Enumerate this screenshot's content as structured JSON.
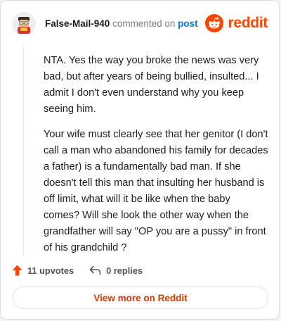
{
  "comment": {
    "username": "False-Mail-940",
    "commented_on_text": "commented on",
    "post_link": "post",
    "paragraphs": [
      "NTA. Yes the way you broke the news was very bad, but after years of being bullied, insulted... I admit I don't even understand why you keep seeing him.",
      "Your wife must clearly see that her genitor (I don't call a man who abandoned his family for decades a father) is a fundamentally bad man. If she doesn't tell this man that insulting her husband is off limit, what will it be like when the baby comes? Will she look the other way when the grandfather will say \"OP you are a pussy\" in front of his grandchild ?"
    ],
    "upvotes_label": "11 upvotes",
    "replies_label": "0 replies"
  },
  "brand": {
    "name": "reddit",
    "icon": "reddit-logo-icon",
    "color": "#ff4500"
  },
  "footer": {
    "view_more_label": "View more on Reddit"
  },
  "colors": {
    "accent_link": "#0079d3",
    "upvote": "#ff4500",
    "view_more_text": "#d93900"
  }
}
